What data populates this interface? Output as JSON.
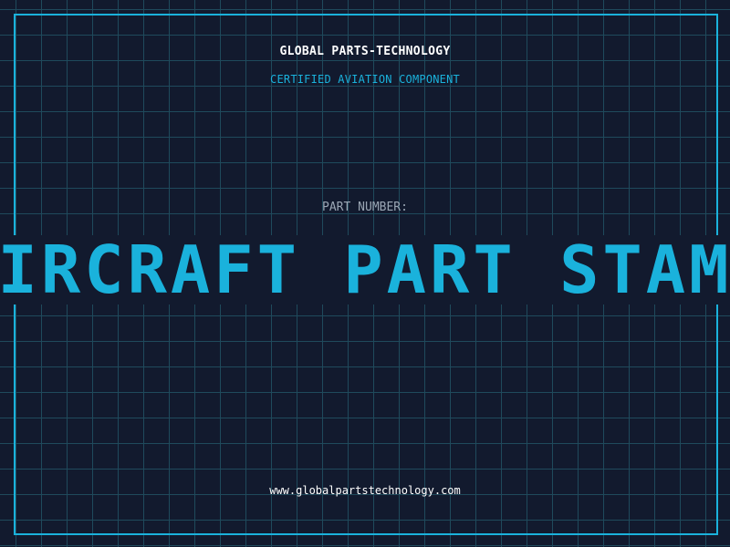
{
  "header": {
    "company": "GLOBAL PARTS-TECHNOLOGY",
    "subtitle": "CERTIFIED AVIATION COMPONENT"
  },
  "main": {
    "part_label": "PART NUMBER:",
    "headline": "AIRCRAFT PART STAMP"
  },
  "footer": {
    "url": "www.globalpartstechnology.com"
  },
  "colors": {
    "background": "#121a2e",
    "grid": "#1f4a5c",
    "accent": "#1ab2dc",
    "text": "#ffffff",
    "muted": "#9aa6b4"
  }
}
